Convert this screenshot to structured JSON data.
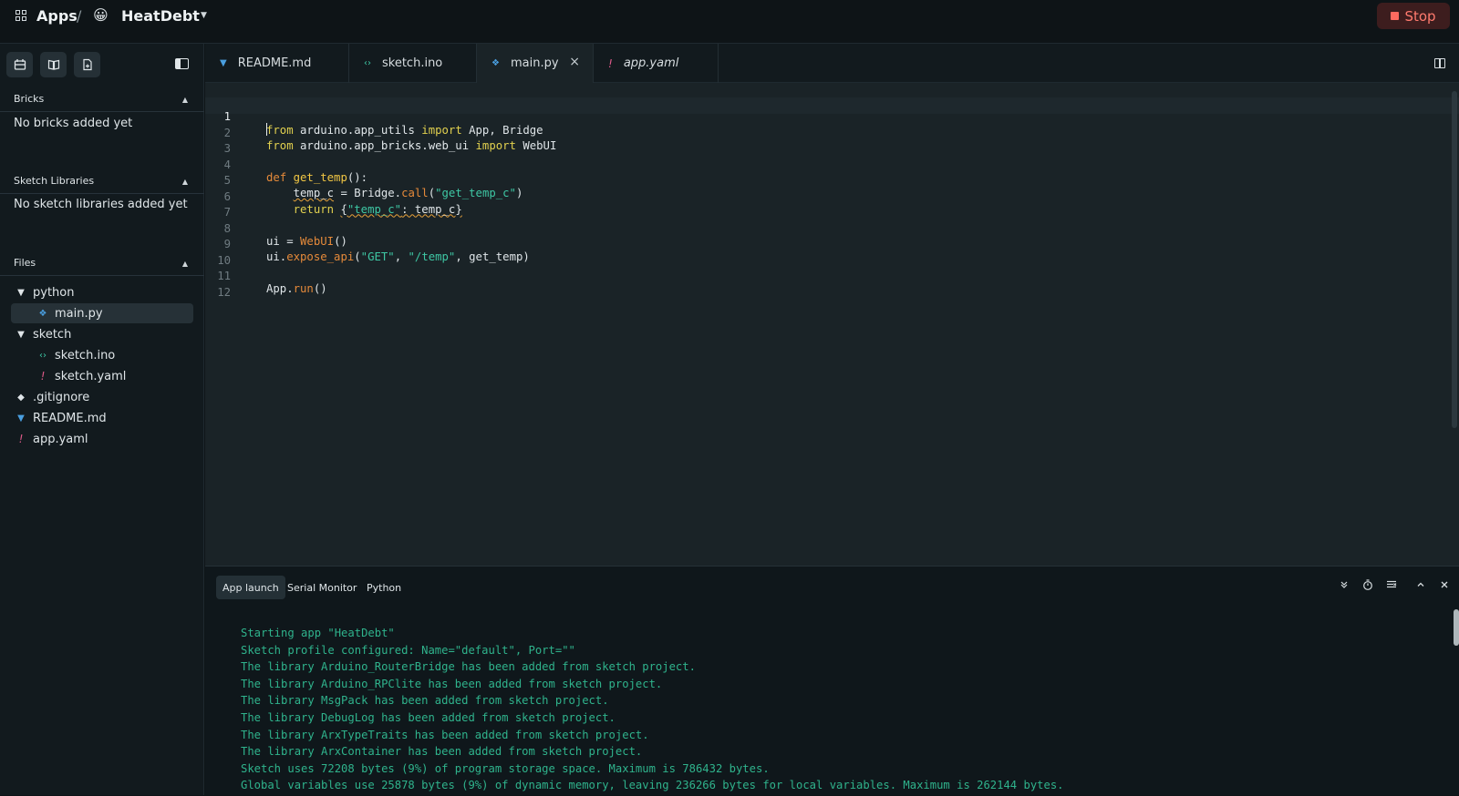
{
  "header": {
    "apps_label": "Apps",
    "separator": "/",
    "app_emoji": "😀",
    "app_name": "HeatDebt",
    "stop_label": "Stop",
    "stop_color": "#ff7a6e"
  },
  "sidebar": {
    "tools": [
      "add-brick-icon",
      "library-icon",
      "add-file-icon"
    ],
    "bricks": {
      "title": "Bricks",
      "empty": "No bricks added yet"
    },
    "libraries": {
      "title": "Sketch Libraries",
      "empty": "No sketch libraries added yet"
    },
    "files": {
      "title": "Files",
      "items": [
        {
          "label": "python",
          "type": "folder"
        },
        {
          "label": "main.py",
          "type": "python"
        },
        {
          "label": "sketch",
          "type": "folder"
        },
        {
          "label": "sketch.ino",
          "type": "ino"
        },
        {
          "label": "sketch.yaml",
          "type": "yaml"
        },
        {
          "label": ".gitignore",
          "type": "git"
        },
        {
          "label": "README.md",
          "type": "md"
        },
        {
          "label": "app.yaml",
          "type": "yaml"
        }
      ]
    }
  },
  "tabs": [
    {
      "label": "README.md",
      "icon": "markdown-icon"
    },
    {
      "label": "sketch.ino",
      "icon": "code-icon"
    },
    {
      "label": "main.py",
      "icon": "python-icon",
      "active": true
    },
    {
      "label": "app.yaml",
      "icon": "yaml-icon"
    }
  ],
  "editor": {
    "line_numbers": [
      "1",
      "2",
      "3",
      "4",
      "5",
      "6",
      "7",
      "8",
      "9",
      "10",
      "11",
      "12"
    ],
    "lines": [
      "from arduino.app_utils import App, Bridge",
      "from arduino.app_bricks.web_ui import WebUI",
      "",
      "def get_temp():",
      "    temp_c = Bridge.call(\"get_temp_c\")",
      "    return {\"temp_c\": temp_c}",
      "",
      "ui = WebUI()",
      "ui.expose_api(\"GET\", \"/temp\", get_temp)",
      "",
      "App.run()",
      ""
    ]
  },
  "console": {
    "tabs": [
      "App launch",
      "Serial Monitor",
      "Python"
    ],
    "lines": [
      "Starting app \"HeatDebt\"",
      "Sketch profile configured: Name=\"default\", Port=\"\"",
      "The library Arduino_RouterBridge has been added from sketch project.",
      "The library Arduino_RPClite has been added from sketch project.",
      "The library MsgPack has been added from sketch project.",
      "The library DebugLog has been added from sketch project.",
      "The library ArxTypeTraits has been added from sketch project.",
      "The library ArxContainer has been added from sketch project.",
      "Sketch uses 72208 bytes (9%) of program storage space. Maximum is 786432 bytes.",
      "Global variables use 25878 bytes (9%) of dynamic memory, leaving 236266 bytes for local variables. Maximum is 262144 bytes."
    ],
    "log_color": "#2fb38c"
  }
}
